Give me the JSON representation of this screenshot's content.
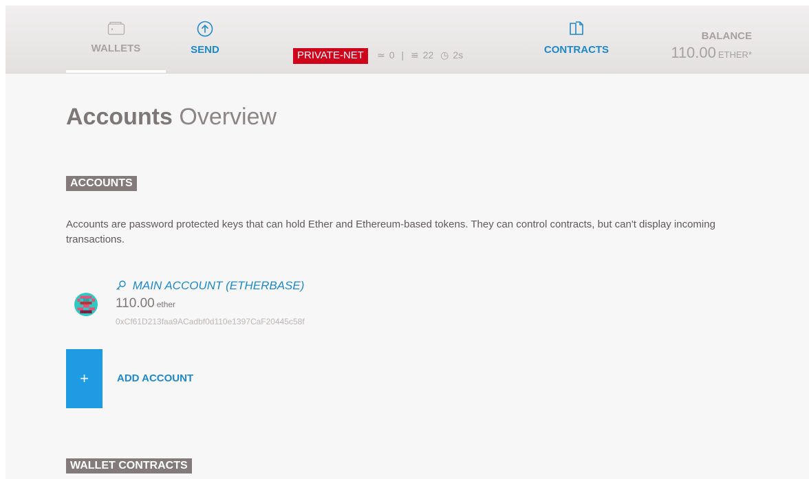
{
  "colors": {
    "accent": "#1e88c8",
    "badge_red": "#d0021b",
    "section_label_bg": "#837b7b",
    "add_button_bg": "#1e9be2"
  },
  "header": {
    "nav": [
      {
        "label": "WALLETS",
        "icon": "wallet-icon",
        "active": true
      },
      {
        "label": "SEND",
        "icon": "send-upload-icon",
        "active": false
      },
      {
        "label": "CONTRACTS",
        "icon": "contracts-documents-icon",
        "active": false
      }
    ],
    "network": {
      "badge": "PRIVATE-NET",
      "peers": "0",
      "separator": "|",
      "block": "22",
      "last_block_time": "2s"
    },
    "balance": {
      "title": "BALANCE",
      "amount": "110.00",
      "unit": "ETHER*"
    }
  },
  "main": {
    "title_strong": "Accounts",
    "title_light": "Overview",
    "accounts_section": {
      "label": "ACCOUNTS",
      "description": "Accounts are password protected keys that can hold Ether and Ethereum-based tokens. They can control contracts, but can't display incoming transactions."
    },
    "accounts": [
      {
        "name": "MAIN ACCOUNT (ETHERBASE)",
        "balance": "110.00",
        "unit": "ether",
        "address": "0xCf61D213faa9ACadbf0d110e1397CaF20445c58f",
        "icon": "key-icon"
      }
    ],
    "add_account": {
      "symbol": "+",
      "label": "ADD ACCOUNT"
    },
    "wallet_contracts_section": {
      "label": "WALLET CONTRACTS"
    }
  }
}
